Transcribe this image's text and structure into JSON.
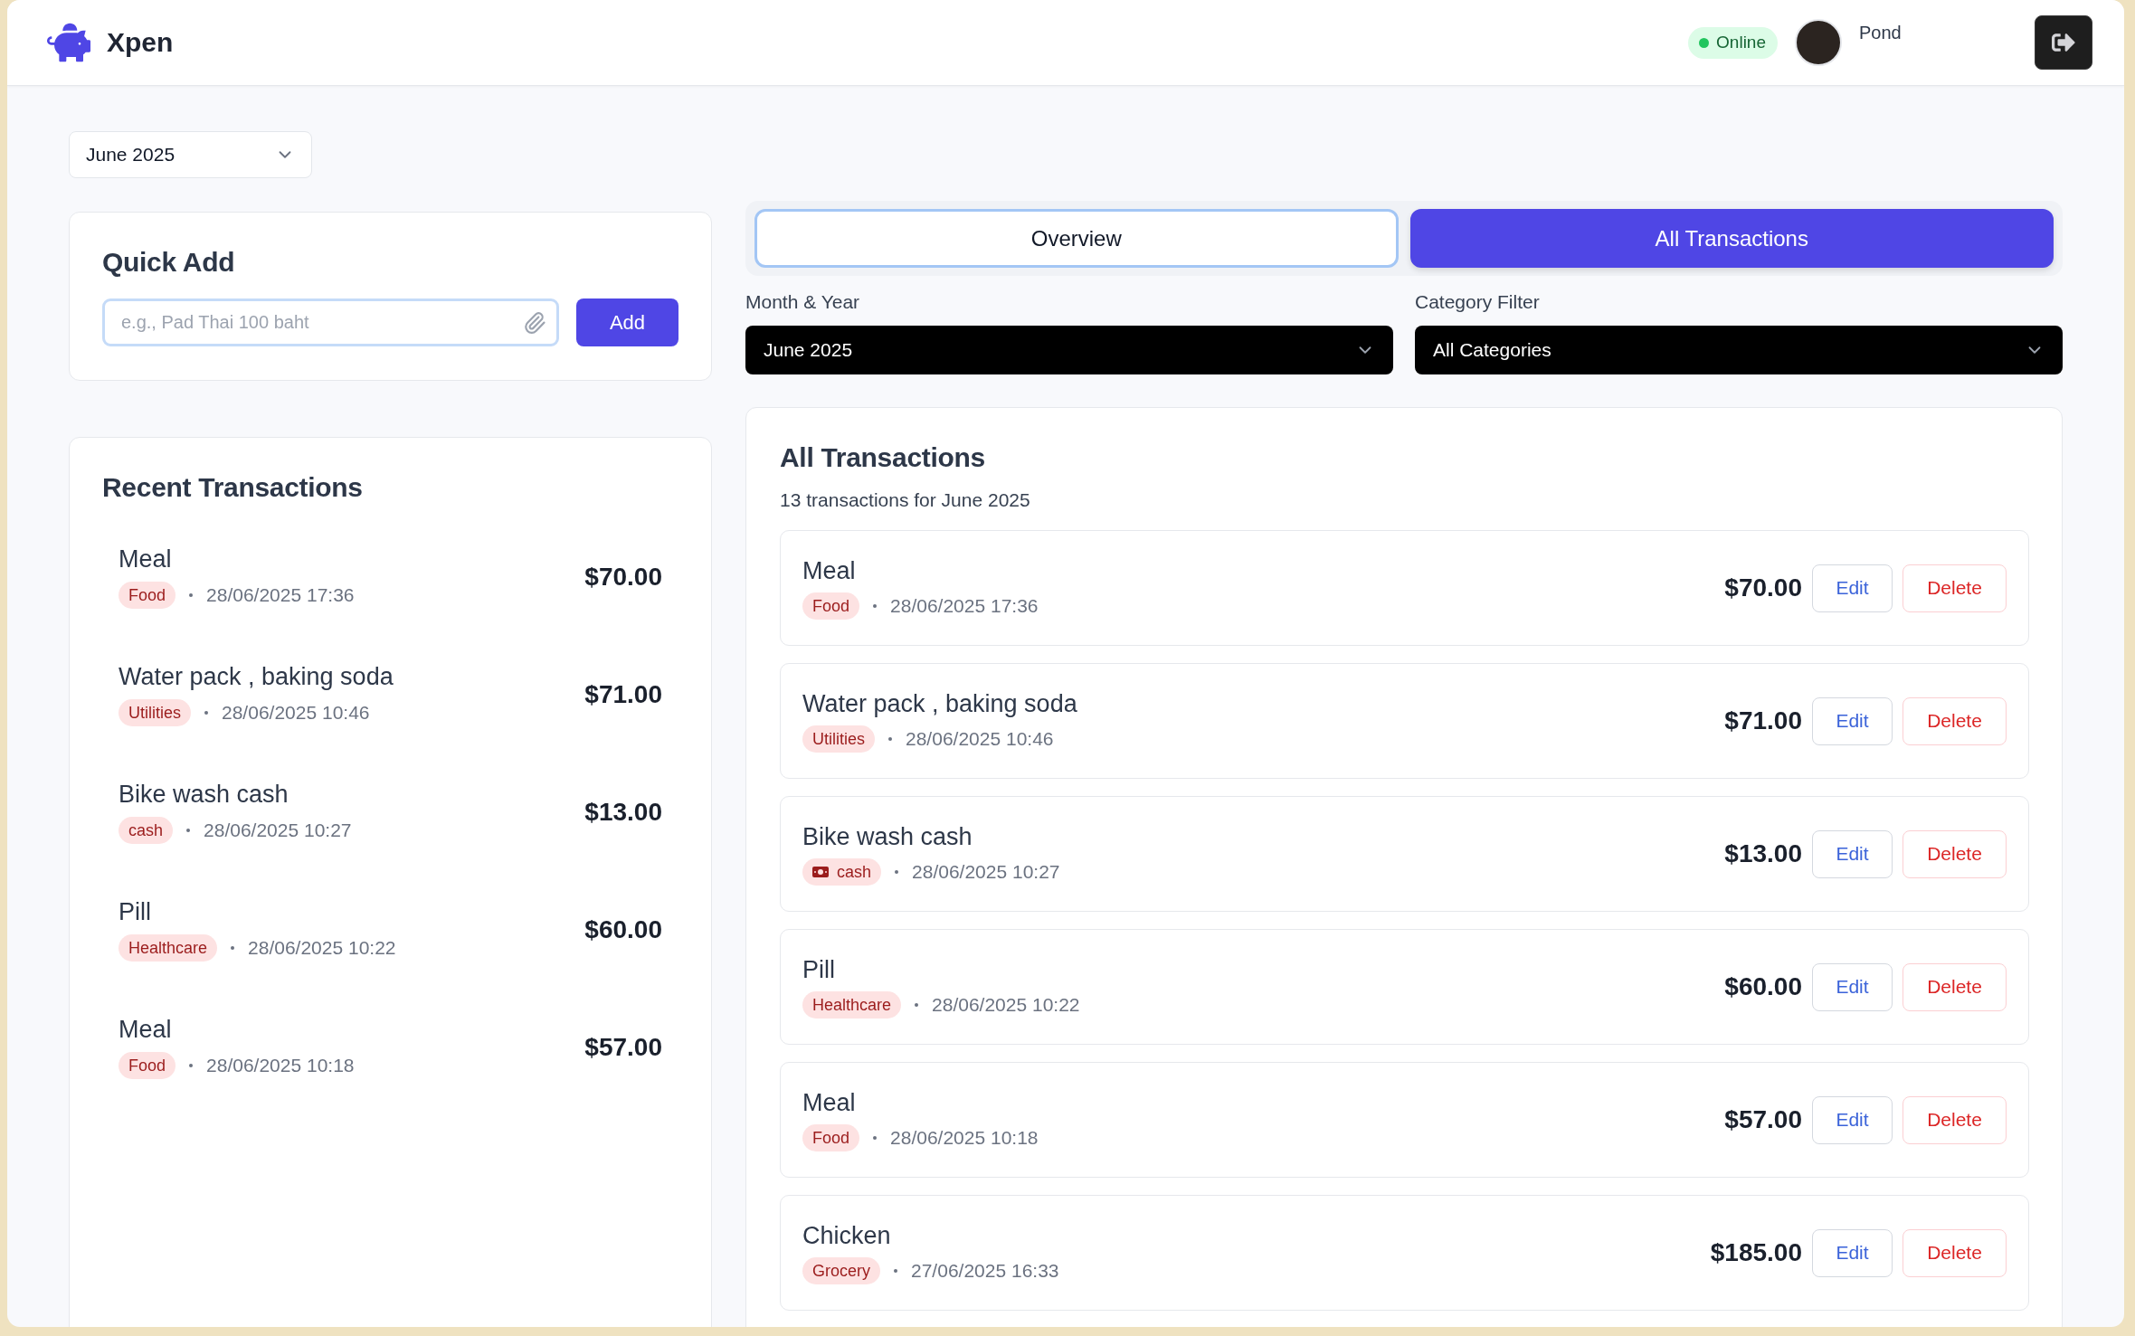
{
  "header": {
    "app_name": "Xpen",
    "status": {
      "label": "Online",
      "online": true
    },
    "user": {
      "name": "Pond"
    }
  },
  "month_picker": {
    "value": "June 2025"
  },
  "quick_add": {
    "title": "Quick Add",
    "input": {
      "placeholder": "e.g., Pad Thai 100 baht"
    },
    "button": "Add"
  },
  "recent_transactions": {
    "title": "Recent Transactions",
    "items": [
      {
        "name": "Meal",
        "category": "Food",
        "datetime": "28/06/2025 17:36",
        "amount": "$70.00"
      },
      {
        "name": "Water pack , baking soda",
        "category": "Utilities",
        "datetime": "28/06/2025 10:46",
        "amount": "$71.00"
      },
      {
        "name": "Bike wash cash",
        "category": "cash",
        "datetime": "28/06/2025 10:27",
        "amount": "$13.00"
      },
      {
        "name": "Pill",
        "category": "Healthcare",
        "datetime": "28/06/2025 10:22",
        "amount": "$60.00"
      },
      {
        "name": "Meal",
        "category": "Food",
        "datetime": "28/06/2025 10:18",
        "amount": "$57.00"
      }
    ]
  },
  "tabs": [
    {
      "label": "Overview",
      "selected": false,
      "focused": true
    },
    {
      "label": "All Transactions",
      "selected": true,
      "focused": false
    }
  ],
  "filters": [
    {
      "label": "Month & Year",
      "value": "June 2025"
    },
    {
      "label": "Category Filter",
      "value": "All Categories"
    }
  ],
  "all_transactions": {
    "title": "All Transactions",
    "subtitle": "13 transactions for June 2025",
    "items": [
      {
        "name": "Meal",
        "category": "Food",
        "category_icon": false,
        "datetime": "28/06/2025 17:36",
        "amount": "$70.00",
        "buttons": [
          {
            "kind": "edit",
            "label": "Edit"
          },
          {
            "kind": "delete",
            "label": "Delete"
          }
        ]
      },
      {
        "name": "Water pack , baking soda",
        "category": "Utilities",
        "category_icon": false,
        "datetime": "28/06/2025 10:46",
        "amount": "$71.00",
        "buttons": [
          {
            "kind": "edit",
            "label": "Edit"
          },
          {
            "kind": "delete",
            "label": "Delete"
          }
        ]
      },
      {
        "name": "Bike wash cash",
        "category": "cash",
        "category_icon": true,
        "datetime": "28/06/2025 10:27",
        "amount": "$13.00",
        "buttons": [
          {
            "kind": "edit",
            "label": "Edit"
          },
          {
            "kind": "delete",
            "label": "Delete"
          }
        ]
      },
      {
        "name": "Pill",
        "category": "Healthcare",
        "category_icon": false,
        "datetime": "28/06/2025 10:22",
        "amount": "$60.00",
        "buttons": [
          {
            "kind": "edit",
            "label": "Edit"
          },
          {
            "kind": "delete",
            "label": "Delete"
          }
        ]
      },
      {
        "name": "Meal",
        "category": "Food",
        "category_icon": false,
        "datetime": "28/06/2025 10:18",
        "amount": "$57.00",
        "buttons": [
          {
            "kind": "edit",
            "label": "Edit"
          },
          {
            "kind": "delete",
            "label": "Delete"
          }
        ]
      },
      {
        "name": "Chicken",
        "category": "Grocery",
        "category_icon": false,
        "datetime": "27/06/2025 16:33",
        "amount": "$185.00",
        "buttons": [
          {
            "kind": "edit",
            "label": "Edit"
          },
          {
            "kind": "delete",
            "label": "Delete"
          }
        ]
      }
    ]
  }
}
